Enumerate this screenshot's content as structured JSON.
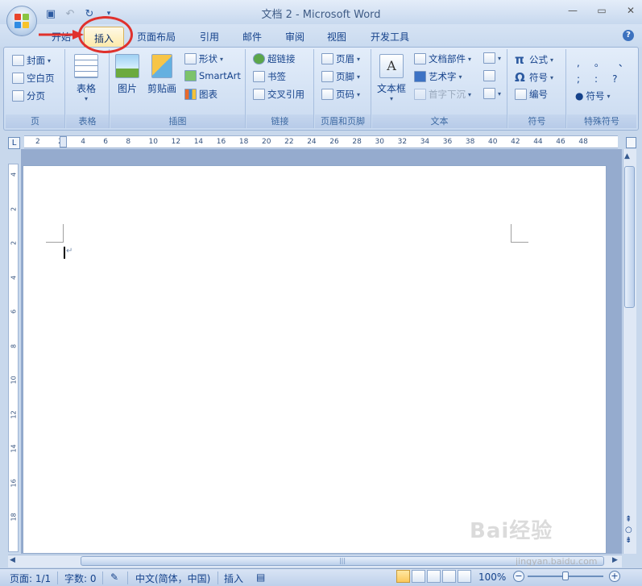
{
  "window": {
    "title": "文档 2 - Microsoft Word"
  },
  "tabs": [
    {
      "id": "home",
      "label": "开始"
    },
    {
      "id": "insert",
      "label": "插入",
      "active": true
    },
    {
      "id": "page_layout",
      "label": "页面布局"
    },
    {
      "id": "references",
      "label": "引用"
    },
    {
      "id": "mailings",
      "label": "邮件"
    },
    {
      "id": "review",
      "label": "审阅"
    },
    {
      "id": "view",
      "label": "视图"
    },
    {
      "id": "developer",
      "label": "开发工具"
    }
  ],
  "ribbon": {
    "pages": {
      "label": "页",
      "cover": "封面",
      "blank": "空白页",
      "break": "分页"
    },
    "tables": {
      "label": "表格",
      "table": "表格"
    },
    "illustrations": {
      "label": "插图",
      "picture": "图片",
      "clipart": "剪贴画",
      "shapes": "形状",
      "smartart": "SmartArt",
      "chart": "图表"
    },
    "links": {
      "label": "链接",
      "hyperlink": "超链接",
      "bookmark": "书签",
      "crossref": "交叉引用"
    },
    "header_footer": {
      "label": "页眉和页脚",
      "header": "页眉",
      "footer": "页脚",
      "page_number": "页码"
    },
    "text": {
      "label": "文本",
      "textbox": "文本框",
      "quickparts": "文档部件",
      "wordart": "艺术字",
      "dropcap": "首字下沉"
    },
    "symbols": {
      "label": "符号",
      "equation": "公式",
      "symbol": "符号",
      "numbering": "编号"
    },
    "special": {
      "label": "特殊符号",
      "symbol": "符号",
      "chars": [
        ",",
        "。",
        "、",
        ";",
        ":",
        "?"
      ]
    }
  },
  "ruler": {
    "h_ticks": [
      "2",
      "2",
      "4",
      "6",
      "8",
      "10",
      "12",
      "14",
      "16",
      "18",
      "20",
      "22",
      "24",
      "26",
      "28",
      "30",
      "32",
      "34",
      "36",
      "38",
      "40",
      "42",
      "44",
      "46",
      "48"
    ],
    "v_ticks": [
      "4",
      "2",
      "2",
      "4",
      "6",
      "8",
      "10",
      "12",
      "14",
      "16",
      "18"
    ]
  },
  "statusbar": {
    "page": "页面: 1/1",
    "words": "字数: 0",
    "language": "中文(简体，中国)",
    "mode": "插入",
    "zoom": "100%"
  },
  "watermark": {
    "text": "Bai经验",
    "url": "jingyan.baidu.com"
  },
  "colors": {
    "ribbon": "#dbe7f7",
    "accent": "#15428b",
    "annotation": "#e0312c",
    "active_tab": "#fde9a8"
  }
}
